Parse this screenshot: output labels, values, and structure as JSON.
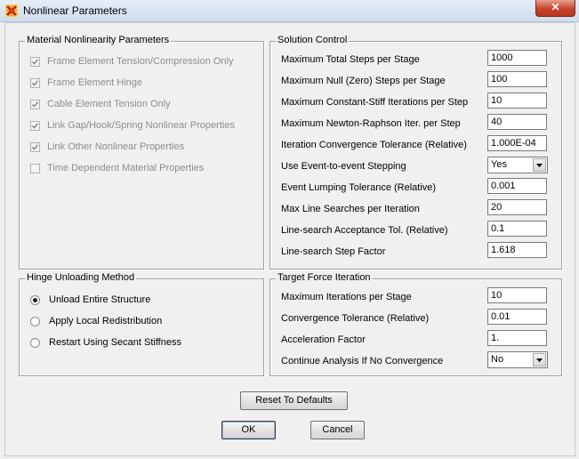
{
  "window": {
    "title": "Nonlinear Parameters",
    "close_glyph": "✕"
  },
  "material": {
    "title": "Material Nonlinearity Parameters",
    "items": [
      {
        "label": "Frame Element Tension/Compression Only",
        "checked": true
      },
      {
        "label": "Frame Element Hinge",
        "checked": true
      },
      {
        "label": "Cable Element Tension Only",
        "checked": true
      },
      {
        "label": "Link Gap/Hook/Spring Nonlinear Properties",
        "checked": true
      },
      {
        "label": "Link Other Nonlinear Properties",
        "checked": true
      },
      {
        "label": "Time Dependent Material Properties",
        "checked": false
      }
    ]
  },
  "solution": {
    "title": "Solution Control",
    "rows": [
      {
        "label": "Maximum Total Steps per Stage",
        "value": "1000"
      },
      {
        "label": "Maximum Null (Zero) Steps per Stage",
        "value": "100"
      },
      {
        "label": "Maximum Constant-Stiff Iterations per Step",
        "value": "10"
      },
      {
        "label": "Maximum Newton-Raphson Iter. per Step",
        "value": "40"
      },
      {
        "label": "Iteration Convergence Tolerance (Relative)",
        "value": "1.000E-04"
      },
      {
        "label": "Use Event-to-event Stepping",
        "value": "Yes"
      },
      {
        "label": "Event Lumping Tolerance (Relative)",
        "value": "0.001"
      },
      {
        "label": "Max Line Searches per Iteration",
        "value": "20"
      },
      {
        "label": "Line-search Acceptance Tol. (Relative)",
        "value": "0.1"
      },
      {
        "label": "Line-search Step Factor",
        "value": "1.618"
      }
    ]
  },
  "hinge": {
    "title": "Hinge Unloading Method",
    "options": [
      {
        "label": "Unload Entire Structure",
        "selected": true
      },
      {
        "label": "Apply Local Redistribution",
        "selected": false
      },
      {
        "label": "Restart Using Secant Stiffness",
        "selected": false
      }
    ]
  },
  "target": {
    "title": "Target Force Iteration",
    "rows": [
      {
        "label": "Maximum Iterations per Stage",
        "value": "10"
      },
      {
        "label": "Convergence Tolerance (Relative)",
        "value": "0.01"
      },
      {
        "label": "Acceleration Factor",
        "value": "1."
      },
      {
        "label": "Continue Analysis If No Convergence",
        "value": "No"
      }
    ]
  },
  "buttons": {
    "reset": "Reset To Defaults",
    "ok": "OK",
    "cancel": "Cancel"
  }
}
